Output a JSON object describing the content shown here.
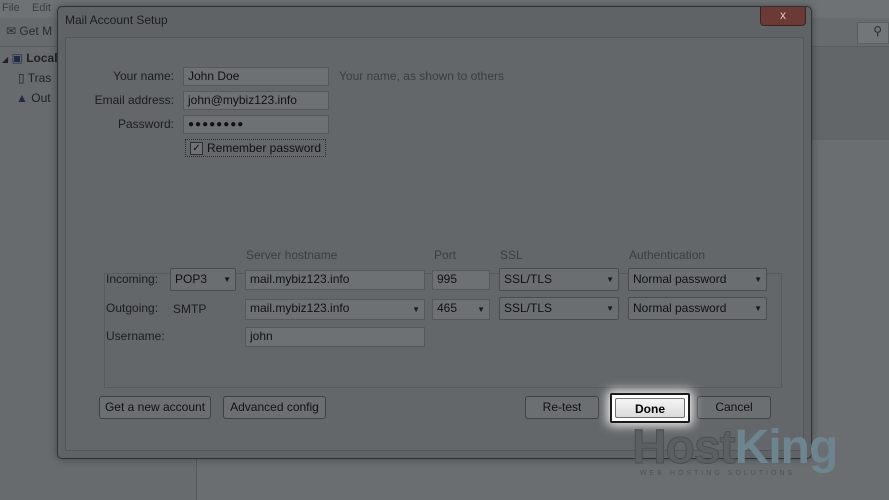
{
  "background": {
    "menu": [
      "File",
      "Edit"
    ],
    "toolbar_get_mail": "Get M",
    "sidebar_items": [
      "Local",
      "Tras",
      "Out"
    ]
  },
  "dialog": {
    "title": "Mail Account Setup",
    "close_label": "x",
    "name_label": "Your name:",
    "name_value": "John Doe",
    "name_hint": "Your name, as shown to others",
    "email_label": "Email address:",
    "email_value": "john@mybiz123.info",
    "password_label": "Password:",
    "password_value": "●●●●●●●●",
    "remember_label": "Remember password",
    "remember_checked": "✓",
    "headers": {
      "server_hostname": "Server hostname",
      "port": "Port",
      "ssl": "SSL",
      "authentication": "Authentication"
    },
    "incoming": {
      "label": "Incoming:",
      "protocol": "POP3",
      "hostname": "mail.mybiz123.info",
      "port": "995",
      "ssl": "SSL/TLS",
      "auth": "Normal password"
    },
    "outgoing": {
      "label": "Outgoing:",
      "protocol": "SMTP",
      "hostname": "mail.mybiz123.info",
      "port": "465",
      "ssl": "SSL/TLS",
      "auth": "Normal password"
    },
    "username_label": "Username:",
    "username_value": "john",
    "buttons": {
      "get_new_account": "Get a new account",
      "advanced_config": "Advanced config",
      "retest": "Re-test",
      "done": "Done",
      "cancel": "Cancel"
    }
  },
  "watermark": {
    "host": "Host",
    "king": "King",
    "tagline": "WEB HOSTING SOLUTIONS"
  }
}
